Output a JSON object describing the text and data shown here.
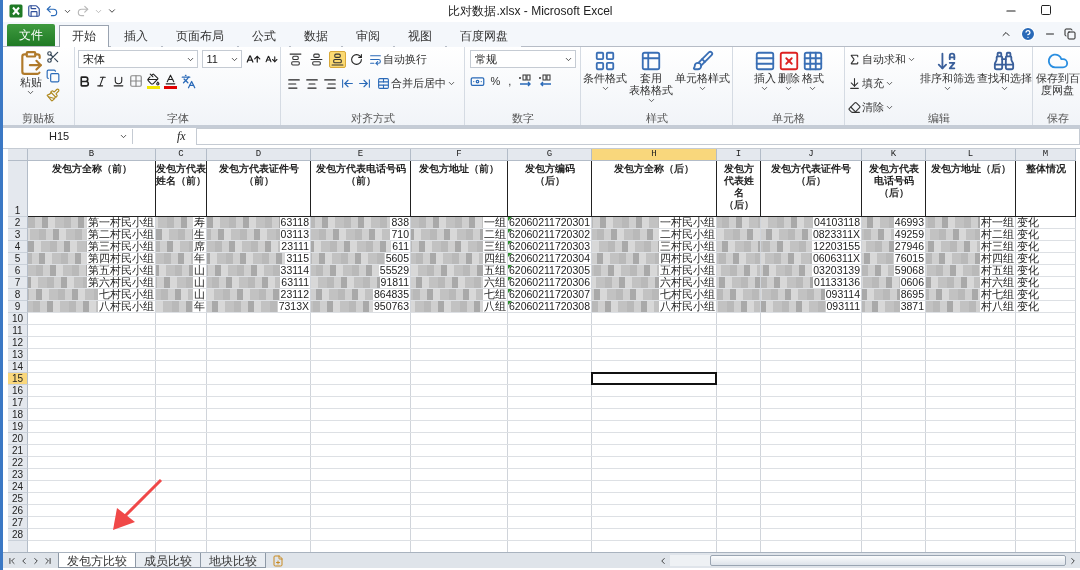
{
  "window": {
    "title": "比对数据.xlsx - Microsoft Excel"
  },
  "quick_access": {
    "redo_enabled": false
  },
  "ribbon_tabs": [
    {
      "label": "文件",
      "kind": "file",
      "selected": false
    },
    {
      "label": "开始",
      "kind": "tab",
      "selected": true
    },
    {
      "label": "插入",
      "kind": "tab",
      "selected": false
    },
    {
      "label": "页面布局",
      "kind": "tab",
      "selected": false
    },
    {
      "label": "公式",
      "kind": "tab",
      "selected": false
    },
    {
      "label": "数据",
      "kind": "tab",
      "selected": false
    },
    {
      "label": "审阅",
      "kind": "tab",
      "selected": false
    },
    {
      "label": "视图",
      "kind": "tab",
      "selected": false
    },
    {
      "label": "百度网盘",
      "kind": "tab",
      "selected": false
    }
  ],
  "ribbon": {
    "clipboard": {
      "label": "剪贴板",
      "paste": "粘贴"
    },
    "font": {
      "label": "字体",
      "font_name": "宋体",
      "font_size": "11"
    },
    "alignment": {
      "label": "对齐方式",
      "vertical_align": [
        {
          "selected": false
        },
        {
          "selected": false
        },
        {
          "selected": true
        }
      ],
      "wrap_text": "自动换行",
      "merge_center": "合并后居中"
    },
    "number": {
      "label": "数字",
      "format": "常规",
      "percent": "%",
      "comma": ","
    },
    "styles": {
      "label": "样式",
      "buttons": [
        {
          "lines": [
            "条件格式"
          ]
        },
        {
          "lines": [
            "套用",
            "表格格式"
          ]
        },
        {
          "lines": [
            "单元格样式"
          ]
        }
      ]
    },
    "cells": {
      "label": "单元格",
      "buttons": [
        "插入",
        "删除",
        "格式"
      ]
    },
    "editing": {
      "label": "编辑",
      "small_buttons": [
        "自动求和",
        "填充",
        "清除"
      ],
      "large_buttons": [
        "排序和筛选",
        "查找和选择"
      ]
    },
    "save": {
      "label": "保存",
      "button": "保存到百度网盘"
    }
  },
  "formula_bar": {
    "name_box": "H15",
    "fx": "fx"
  },
  "header_row": {
    "number": "1"
  },
  "columns": [
    {
      "letter": "B",
      "header": "发包方全称（前）",
      "selected": false
    },
    {
      "letter": "C",
      "header": "发包方代表姓名（前）",
      "selected": false
    },
    {
      "letter": "D",
      "header": "发包方代表证件号（前）",
      "selected": false
    },
    {
      "letter": "E",
      "header": "发包方代表电话号码（前）",
      "selected": false
    },
    {
      "letter": "F",
      "header": "发包方地址（前）",
      "selected": false
    },
    {
      "letter": "G",
      "header": "发包方编码（后）",
      "selected": false
    },
    {
      "letter": "H",
      "header": "发包方全称（后）",
      "selected": true
    },
    {
      "letter": "I",
      "header": "发包方代表姓名（后）",
      "selected": false
    },
    {
      "letter": "J",
      "header": "发包方代表证件号（后）",
      "selected": false
    },
    {
      "letter": "K",
      "header": "发包方代表电话号码（后）",
      "selected": false
    },
    {
      "letter": "L",
      "header": "发包方地址（后）",
      "selected": false
    },
    {
      "letter": "M",
      "header": "整体情况",
      "selected": false
    }
  ],
  "rows": [
    {
      "number": "2",
      "selected": false,
      "cells": [
        {
          "text": "第一村民小组",
          "redacted": true,
          "warning": false
        },
        {
          "text": "寿",
          "redacted": true,
          "warning": false
        },
        {
          "text": "63118",
          "redacted": true,
          "warning": false
        },
        {
          "text": "838",
          "redacted": true,
          "warning": false
        },
        {
          "text": "一组",
          "redacted": true,
          "warning": false
        },
        {
          "text": "62060211720301",
          "redacted": false,
          "warning": true
        },
        {
          "text": "一村民小组",
          "redacted": true,
          "warning": false
        },
        {
          "redacted": true,
          "warning": false
        },
        {
          "text": "04103118",
          "redacted": true,
          "warning": false
        },
        {
          "text": "46993",
          "redacted": true,
          "warning": false
        },
        {
          "text": "村一组",
          "redacted": true,
          "warning": false
        },
        {
          "text": "变化",
          "redacted": false,
          "warning": false
        }
      ]
    },
    {
      "number": "3",
      "selected": false,
      "cells": [
        {
          "text": "第二村民小组",
          "redacted": true,
          "warning": false
        },
        {
          "text": "生",
          "redacted": true,
          "warning": false
        },
        {
          "text": "03113",
          "redacted": true,
          "warning": false
        },
        {
          "text": "710",
          "redacted": true,
          "warning": false
        },
        {
          "text": "二组",
          "redacted": true,
          "warning": false
        },
        {
          "text": "62060211720302",
          "redacted": false,
          "warning": true
        },
        {
          "text": "二村民小组",
          "redacted": true,
          "warning": false
        },
        {
          "redacted": true,
          "warning": false
        },
        {
          "text": "0823311X",
          "redacted": true,
          "warning": false
        },
        {
          "text": "49259",
          "redacted": true,
          "warning": false
        },
        {
          "text": "村二组",
          "redacted": true,
          "warning": false
        },
        {
          "text": "变化",
          "redacted": false,
          "warning": false
        }
      ]
    },
    {
      "number": "4",
      "selected": false,
      "cells": [
        {
          "text": "第三村民小组",
          "redacted": true,
          "warning": false
        },
        {
          "text": "席",
          "redacted": true,
          "warning": false
        },
        {
          "text": "23111",
          "redacted": true,
          "warning": false
        },
        {
          "text": "611",
          "redacted": true,
          "warning": false
        },
        {
          "text": "三组",
          "redacted": true,
          "warning": false
        },
        {
          "text": "62060211720303",
          "redacted": false,
          "warning": true
        },
        {
          "text": "三村民小组",
          "redacted": true,
          "warning": false
        },
        {
          "redacted": true,
          "warning": false
        },
        {
          "text": "12203155",
          "redacted": true,
          "warning": false
        },
        {
          "text": "27946",
          "redacted": true,
          "warning": false
        },
        {
          "text": "村三组",
          "redacted": true,
          "warning": false
        },
        {
          "text": "变化",
          "redacted": false,
          "warning": false
        }
      ]
    },
    {
      "number": "5",
      "selected": false,
      "cells": [
        {
          "text": "第四村民小组",
          "redacted": true,
          "warning": false
        },
        {
          "text": "年",
          "redacted": true,
          "warning": false
        },
        {
          "text": "3115",
          "redacted": true,
          "warning": false
        },
        {
          "text": "5605",
          "redacted": true,
          "warning": false
        },
        {
          "text": "四组",
          "redacted": true,
          "warning": false
        },
        {
          "text": "62060211720304",
          "redacted": false,
          "warning": true
        },
        {
          "text": "四村民小组",
          "redacted": true,
          "warning": false
        },
        {
          "redacted": true,
          "warning": false
        },
        {
          "text": "0606311X",
          "redacted": true,
          "warning": false
        },
        {
          "text": "76015",
          "redacted": true,
          "warning": false
        },
        {
          "text": "村四组",
          "redacted": true,
          "warning": false
        },
        {
          "text": "变化",
          "redacted": false,
          "warning": false
        }
      ]
    },
    {
      "number": "6",
      "selected": false,
      "cells": [
        {
          "text": "第五村民小组",
          "redacted": true,
          "warning": false
        },
        {
          "text": "山",
          "redacted": true,
          "warning": false
        },
        {
          "text": "33114",
          "redacted": true,
          "warning": false
        },
        {
          "text": "55529",
          "redacted": true,
          "warning": false
        },
        {
          "text": "五组",
          "redacted": true,
          "warning": false
        },
        {
          "text": "62060211720305",
          "redacted": false,
          "warning": true
        },
        {
          "text": "五村民小组",
          "redacted": true,
          "warning": false
        },
        {
          "redacted": true,
          "warning": false
        },
        {
          "text": "03203139",
          "redacted": true,
          "warning": false
        },
        {
          "text": "59068",
          "redacted": true,
          "warning": false
        },
        {
          "text": "村五组",
          "redacted": true,
          "warning": false
        },
        {
          "text": "变化",
          "redacted": false,
          "warning": false
        }
      ]
    },
    {
      "number": "7",
      "selected": false,
      "cells": [
        {
          "text": "第六村民小组",
          "redacted": true,
          "warning": false
        },
        {
          "text": "山",
          "redacted": true,
          "warning": false
        },
        {
          "text": "63111",
          "redacted": true,
          "warning": false
        },
        {
          "text": "91811",
          "redacted": true,
          "warning": false
        },
        {
          "text": "六组",
          "redacted": true,
          "warning": false
        },
        {
          "text": "62060211720306",
          "redacted": false,
          "warning": true
        },
        {
          "text": "六村民小组",
          "redacted": true,
          "warning": false
        },
        {
          "redacted": true,
          "warning": false
        },
        {
          "text": "01133136",
          "redacted": true,
          "warning": false
        },
        {
          "text": "0606",
          "redacted": true,
          "warning": false
        },
        {
          "text": "村六组",
          "redacted": true,
          "warning": false
        },
        {
          "text": "变化",
          "redacted": false,
          "warning": false
        }
      ]
    },
    {
      "number": "8",
      "selected": false,
      "cells": [
        {
          "text": "七村民小组",
          "redacted": true,
          "warning": false
        },
        {
          "text": "山",
          "redacted": true,
          "warning": false
        },
        {
          "text": "23112",
          "redacted": true,
          "warning": false
        },
        {
          "text": "864835",
          "redacted": true,
          "warning": false
        },
        {
          "text": "七组",
          "redacted": true,
          "warning": false
        },
        {
          "text": "62060211720307",
          "redacted": false,
          "warning": true
        },
        {
          "text": "七村民小组",
          "redacted": true,
          "warning": false
        },
        {
          "redacted": true,
          "warning": false
        },
        {
          "text": "093114",
          "redacted": true,
          "warning": false
        },
        {
          "text": "8695",
          "redacted": true,
          "warning": false
        },
        {
          "text": "村七组",
          "redacted": true,
          "warning": false
        },
        {
          "text": "变化",
          "redacted": false,
          "warning": false
        }
      ]
    },
    {
      "number": "9",
      "selected": false,
      "cells": [
        {
          "text": "八村民小组",
          "redacted": true,
          "warning": false
        },
        {
          "text": "年",
          "redacted": true,
          "warning": false
        },
        {
          "text": "7313X",
          "redacted": true,
          "warning": false
        },
        {
          "text": "950763",
          "redacted": true,
          "warning": false
        },
        {
          "text": "八组",
          "redacted": true,
          "warning": false
        },
        {
          "text": "62060211720308",
          "redacted": false,
          "warning": true
        },
        {
          "text": "八村民小组",
          "redacted": true,
          "warning": false
        },
        {
          "redacted": true,
          "warning": false
        },
        {
          "text": "093111",
          "redacted": true,
          "warning": false
        },
        {
          "text": "3871",
          "redacted": true,
          "warning": false
        },
        {
          "text": "村八组",
          "redacted": true,
          "warning": false
        },
        {
          "text": "变化",
          "redacted": false,
          "warning": false
        }
      ]
    }
  ],
  "empty_rows": [
    {
      "number": "10",
      "selected": false
    },
    {
      "number": "11",
      "selected": false
    },
    {
      "number": "12",
      "selected": false
    },
    {
      "number": "13",
      "selected": false
    },
    {
      "number": "14",
      "selected": false
    },
    {
      "number": "15",
      "selected": true
    },
    {
      "number": "16",
      "selected": false
    },
    {
      "number": "17",
      "selected": false
    },
    {
      "number": "18",
      "selected": false
    },
    {
      "number": "19",
      "selected": false
    },
    {
      "number": "20",
      "selected": false
    },
    {
      "number": "21",
      "selected": false
    },
    {
      "number": "22",
      "selected": false
    },
    {
      "number": "23",
      "selected": false
    },
    {
      "number": "24",
      "selected": false
    },
    {
      "number": "25",
      "selected": false
    },
    {
      "number": "26",
      "selected": false
    },
    {
      "number": "27",
      "selected": false
    },
    {
      "number": "28",
      "selected": false
    }
  ],
  "sheet_tabs": [
    {
      "label": "发包方比较",
      "selected": true
    },
    {
      "label": "成员比较",
      "selected": false
    },
    {
      "label": "地块比较",
      "selected": false
    }
  ]
}
